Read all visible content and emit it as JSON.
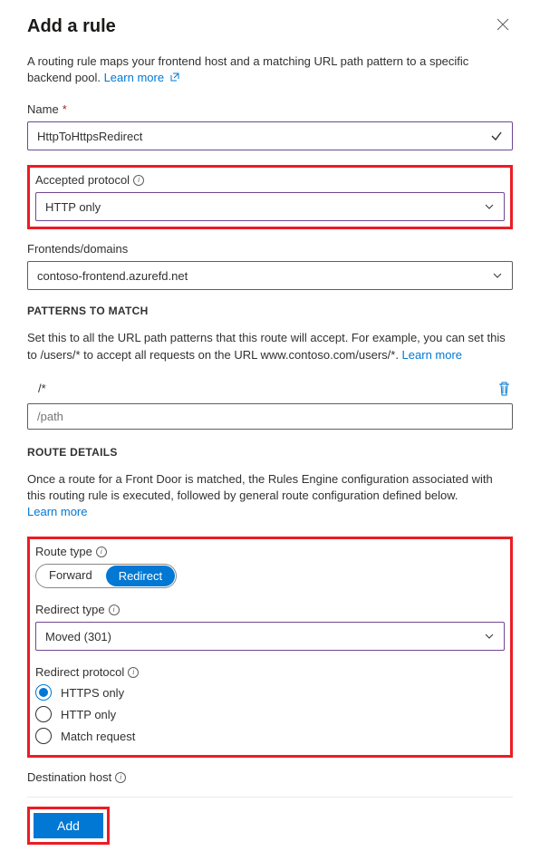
{
  "header": {
    "title": "Add a rule"
  },
  "intro": {
    "text": "A routing rule maps your frontend host and a matching URL path pattern to a specific backend pool. ",
    "learn_more": "Learn more"
  },
  "name": {
    "label": "Name",
    "value": "HttpToHttpsRedirect",
    "required": "*"
  },
  "accepted_protocol": {
    "label": "Accepted protocol",
    "value": "HTTP only"
  },
  "frontends": {
    "label": "Frontends/domains",
    "value": "contoso-frontend.azurefd.net"
  },
  "patterns": {
    "section_title": "Patterns to match",
    "help": "Set this to all the URL path patterns that this route will accept. For example, you can set this to /users/* to accept all requests on the URL www.contoso.com/users/*. ",
    "learn_more": "Learn more",
    "items": [
      "/*"
    ],
    "input_placeholder": "/path"
  },
  "route_details": {
    "section_title": "Route details",
    "help": "Once a route for a Front Door is matched, the Rules Engine configuration associated with this routing rule is executed, followed by general route configuration defined below. ",
    "learn_more": "Learn more",
    "route_type": {
      "label": "Route type",
      "forward": "Forward",
      "redirect": "Redirect"
    },
    "redirect_type": {
      "label": "Redirect type",
      "value": "Moved (301)"
    },
    "redirect_protocol": {
      "label": "Redirect protocol",
      "options": [
        "HTTPS only",
        "HTTP only",
        "Match request"
      ],
      "selected": "HTTPS only"
    }
  },
  "destination_host": {
    "label": "Destination host"
  },
  "add_button": "Add"
}
